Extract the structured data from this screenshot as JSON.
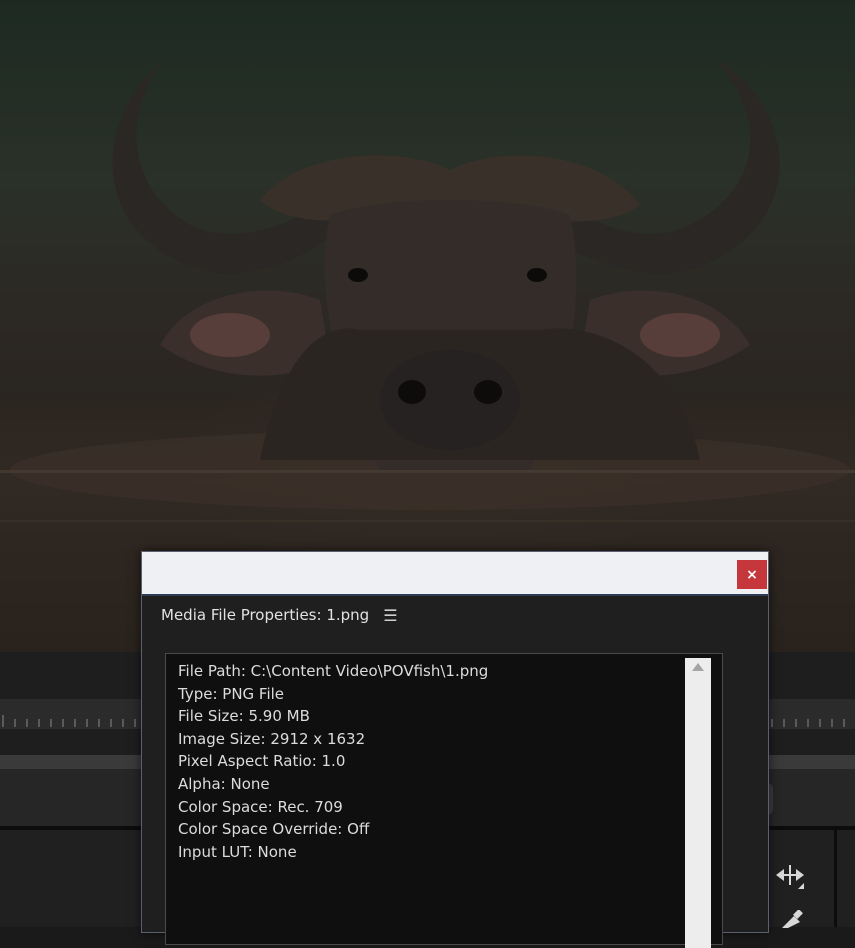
{
  "dialog": {
    "title": "Media File Properties: 1.png",
    "close_label": "×",
    "menu_icon": "hamburger-menu-icon",
    "properties": [
      "File Path: C:\\Content Video\\POVfish\\1.png",
      "Type: PNG File",
      "File Size: 5.90 MB",
      "Image Size: 2912 x 1632",
      "Pixel Aspect Ratio: 1.0",
      "Alpha: None",
      "Color Space: Rec. 709",
      "Color Space Override: Off",
      "Input LUT: None"
    ]
  },
  "toolbar_icons": [
    "ripple-edit-icon",
    "pen-icon"
  ],
  "colors": {
    "close_button": "#c6373b",
    "dialog_title_bar": "#eef0f3",
    "panel_background": "#1f1f1f"
  }
}
